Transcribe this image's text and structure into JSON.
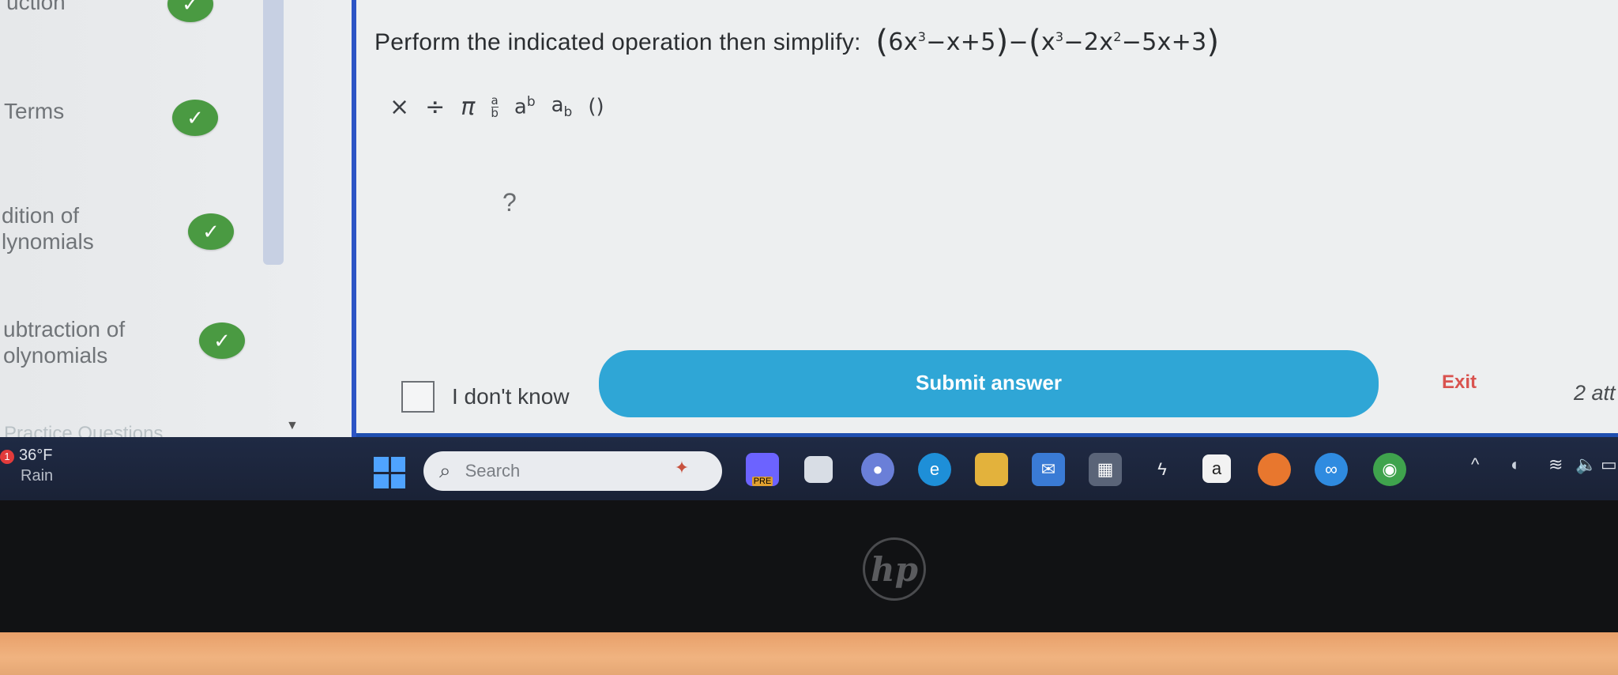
{
  "sidebar": {
    "items": [
      {
        "label": "uction",
        "done": true
      },
      {
        "label": "Terms",
        "done": true
      },
      {
        "label": "dition of\nlynomials",
        "done": true
      },
      {
        "label": "ubtraction of\nolynomials",
        "done": true
      }
    ],
    "faded_item": "Practice Questions",
    "check_glyph": "✓"
  },
  "question": {
    "prompt": "Perform the indicated operation then simplify:",
    "expr": {
      "open1": "(",
      "t1": "6x",
      "e1": "3",
      "t2": "−x+5",
      "close1": ")",
      "minus": "−",
      "open2": "(",
      "t3": "x",
      "e3": "3",
      "t4": "−2x",
      "e4": "2",
      "t5": "−5x+3",
      "close2": ")"
    }
  },
  "toolbar": {
    "times": "×",
    "divide": "÷",
    "pi": "π",
    "fraction_num": "a",
    "fraction_den": "b",
    "power_base": "a",
    "power_exp": "b",
    "sub_base": "a",
    "sub_idx": "b",
    "parens": "()"
  },
  "answer": {
    "placeholder": "?"
  },
  "idk_label": "I don't know",
  "submit_label": "Submit answer",
  "exit_label": "Exit",
  "attempts_label": "2 att",
  "taskbar": {
    "weather_badge": "1",
    "temperature": "36°F",
    "weather_text": "Rain",
    "search_placeholder": "Search",
    "search_icon": "search-icon",
    "tray_chevron": "^",
    "app_letter_a": "a",
    "app_pre": "PRE"
  },
  "bezel": {
    "logo": "hp"
  },
  "colors": {
    "accent": "#2c54c5",
    "submit": "#2fa6d6",
    "check": "#4a9a42",
    "exit": "#d9534f"
  }
}
